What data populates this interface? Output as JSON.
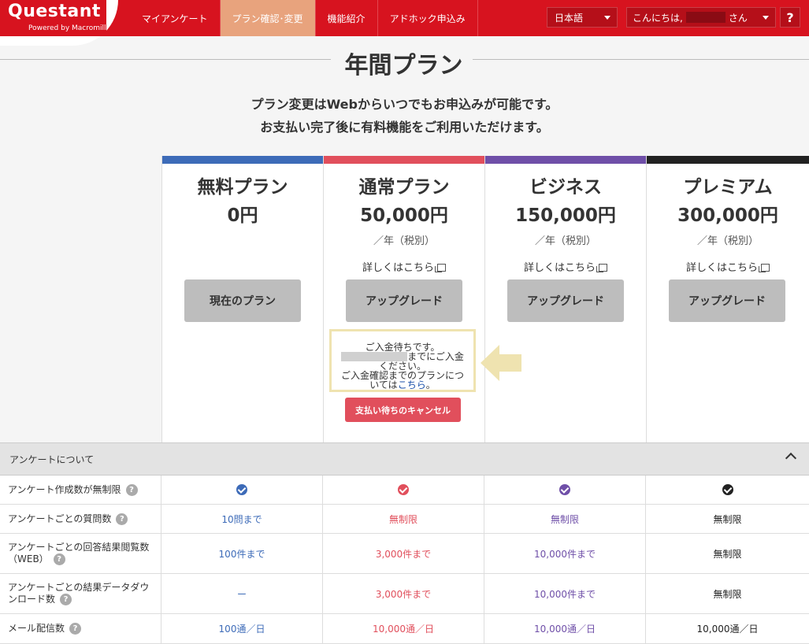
{
  "app": {
    "logo_title": "Questant",
    "logo_sub": "Powered by Macromill"
  },
  "nav": {
    "items": [
      {
        "label": "マイアンケート"
      },
      {
        "label": "プラン確認･変更"
      },
      {
        "label": "機能紹介"
      },
      {
        "label": "アドホック申込み"
      }
    ],
    "active": "プラン確認･変更"
  },
  "header": {
    "language": "日本語",
    "greeting_prefix": "こんにちは,",
    "greeting_suffix": "さん",
    "help": "?"
  },
  "page": {
    "title": "年間プラン",
    "intro_line1": "プラン変更はWebからいつでもお申込みが可能です。",
    "intro_line2": "お支払い完了後に有料機能をご利用いただけます。"
  },
  "plans": [
    {
      "name": "無料プラン",
      "price": "0円",
      "per": "",
      "detail": "",
      "button": "現在のプラン",
      "color": "#3d6bb8"
    },
    {
      "name": "通常プラン",
      "price": "50,000円",
      "per": "／年（税別）",
      "detail": "詳しくはこちら",
      "button": "アップグレード",
      "color": "#e14f5c"
    },
    {
      "name": "ビジネス",
      "price": "150,000円",
      "per": "／年（税別）",
      "detail": "詳しくはこちら",
      "button": "アップグレード",
      "color": "#6f4fa8"
    },
    {
      "name": "プレミアム",
      "price": "300,000円",
      "per": "／年（税別）",
      "detail": "詳しくはこちら",
      "button": "アップグレード",
      "color": "#222222"
    }
  ],
  "notice": {
    "line1": "ご入金待ちです。",
    "line2": "までにご入金",
    "line3": "ください。",
    "line4": "ご入金確認までのプランにつ",
    "line5_prefix": "いては",
    "link": "こちら",
    "line5_suffix": "。",
    "cancel_button": "支払い待ちのキャンセル"
  },
  "section": {
    "title": "アンケートについて"
  },
  "features": [
    {
      "label": "アンケート作成数が無制限",
      "values": [
        "check",
        "check",
        "check",
        "check"
      ]
    },
    {
      "label": "アンケートごとの質問数",
      "values": [
        "10問まで",
        "無制限",
        "無制限",
        "無制限"
      ]
    },
    {
      "label": "アンケートごとの回答結果閲覧数（WEB）",
      "values": [
        "100件まで",
        "3,000件まで",
        "10,000件まで",
        "無制限"
      ]
    },
    {
      "label": "アンケートごとの結果データダウンロード数",
      "values": [
        "ー",
        "3,000件まで",
        "10,000件まで",
        "無制限"
      ]
    },
    {
      "label": "メール配信数",
      "values": [
        "100通／日",
        "10,000通／日",
        "10,000通／日",
        "10,000通／日"
      ]
    }
  ],
  "icons": {
    "check": "check-circle-icon",
    "help": "question-icon",
    "external": "external-window-icon",
    "collapse": "chevron-up-icon",
    "arrow": "arrow-left-icon"
  }
}
